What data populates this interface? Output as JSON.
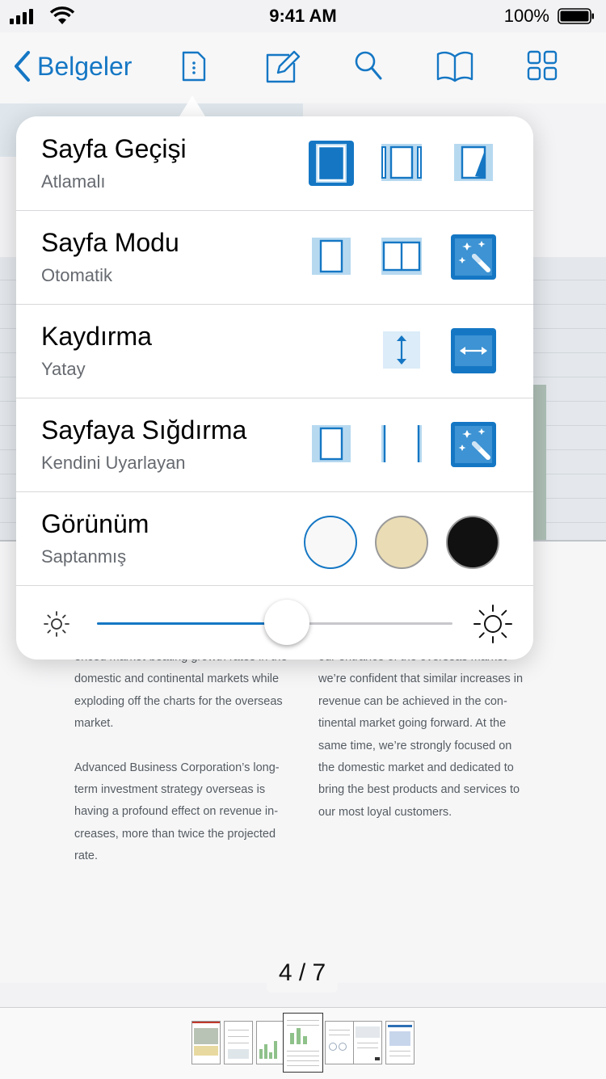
{
  "status_bar": {
    "time": "9:41 AM",
    "battery": "100%"
  },
  "toolbar": {
    "back_label": "Belgeler",
    "icons": [
      "document-icon",
      "edit-icon",
      "search-icon",
      "book-icon",
      "grid-icon"
    ]
  },
  "popover": {
    "rows": [
      {
        "title": "Sayfa Geçişi",
        "subtitle": "Atlamalı"
      },
      {
        "title": "Sayfa Modu",
        "subtitle": "Otomatik"
      },
      {
        "title": "Kaydırma",
        "subtitle": "Yatay"
      },
      {
        "title": "Sayfaya Sığdırma",
        "subtitle": "Kendini Uyarlayan"
      },
      {
        "title": "Görünüm",
        "subtitle": "Saptanmış"
      }
    ],
    "brightness": 0.535
  },
  "document": {
    "col1_para1": "enced market-beating growth rates in the domestic and continental markets while exploding off the charts for the overseas market.",
    "col1_para2": "Advanced Business Corporation’s long-term investment strategy overseas is having a profound effect on revenue in-creases, more than twice the projected rate.",
    "col2_para1": "our entrance of the overseas market we’re confident that similar increases in revenue can be achieved in the con-tinental market going forward. At the same time, we’re strongly focused on the domestic market and dedicated to bring the best products and services to our most loyal customers.",
    "page_indicator": "4 / 7"
  },
  "colors": {
    "accent": "#1577c4",
    "selected_fill": "#1577c4",
    "option_bg": "#b7d9f0"
  }
}
